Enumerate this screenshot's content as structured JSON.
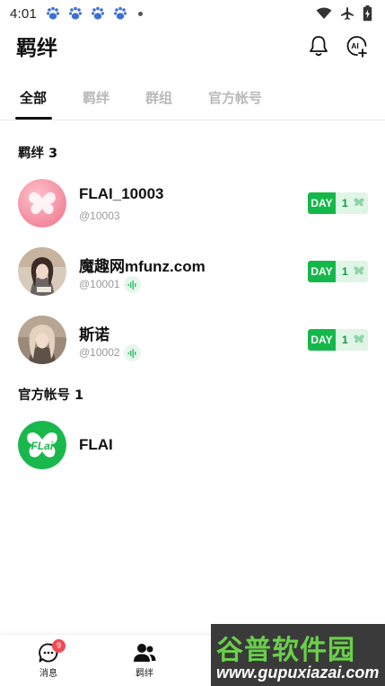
{
  "status_bar": {
    "time": "4:01"
  },
  "header": {
    "title": "羁绊"
  },
  "tabs": [
    {
      "label": "全部",
      "active": true
    },
    {
      "label": "羁绊",
      "active": false
    },
    {
      "label": "群组",
      "active": false
    },
    {
      "label": "官方帐号",
      "active": false
    }
  ],
  "sections": {
    "bonds": {
      "title": "羁绊 3",
      "items": [
        {
          "name": "FLAI_10003",
          "handle": "@10003",
          "has_voice": false,
          "day_label": "DAY",
          "day_count": "1"
        },
        {
          "name": "魔趣网mfunz.com",
          "handle": "@10001",
          "has_voice": true,
          "day_label": "DAY",
          "day_count": "1"
        },
        {
          "name": "斯诺",
          "handle": "@10002",
          "has_voice": true,
          "day_label": "DAY",
          "day_count": "1"
        }
      ]
    },
    "official": {
      "title": "官方帐号 1",
      "items": [
        {
          "name": "FLAI"
        }
      ]
    }
  },
  "bottom_nav": [
    {
      "label": "消息",
      "badge": "9"
    },
    {
      "label": "羁绊"
    }
  ],
  "watermark": {
    "title": "谷普软件园",
    "url": "www.gupuxiazai.com"
  },
  "colors": {
    "accent_green": "#14b84a",
    "badge_red": "#f04a52",
    "paw_blue": "#3d6fd6"
  }
}
